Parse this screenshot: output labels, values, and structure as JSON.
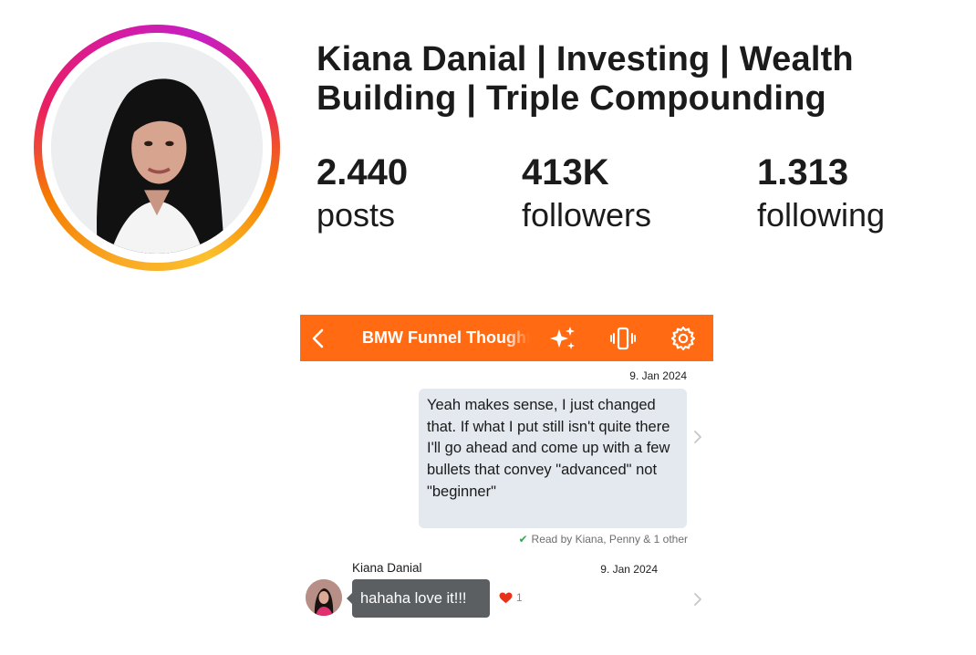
{
  "profile": {
    "name": "Kiana Danial | Investing | Wealth Building | Triple Compounding",
    "stats": {
      "posts_value": "2.440",
      "posts_label": "posts",
      "followers_value": "413K",
      "followers_label": "followers",
      "following_value": "1.313",
      "following_label": "following"
    }
  },
  "chat": {
    "header": {
      "title": "BMW Funnel Thoughts",
      "background": "#ff6a13",
      "icons": [
        "chevron-left-icon",
        "sparkle-icon",
        "vibrate-phone-icon",
        "gear-icon"
      ]
    },
    "messages": [
      {
        "date": "9. Jan 2024",
        "text": "Yeah makes sense, I just changed that. If what I put still isn't quite there I'll go ahead and come up with a few bullets that convey \"advanced\" not \"beginner\"",
        "read_receipt": "Read by Kiana, Penny & 1 other"
      },
      {
        "sender": "Kiana Danial",
        "date": "9. Jan 2024",
        "text": "hahaha love it!!!",
        "reaction_count": "1",
        "reaction_icon": "heart-icon"
      }
    ]
  }
}
